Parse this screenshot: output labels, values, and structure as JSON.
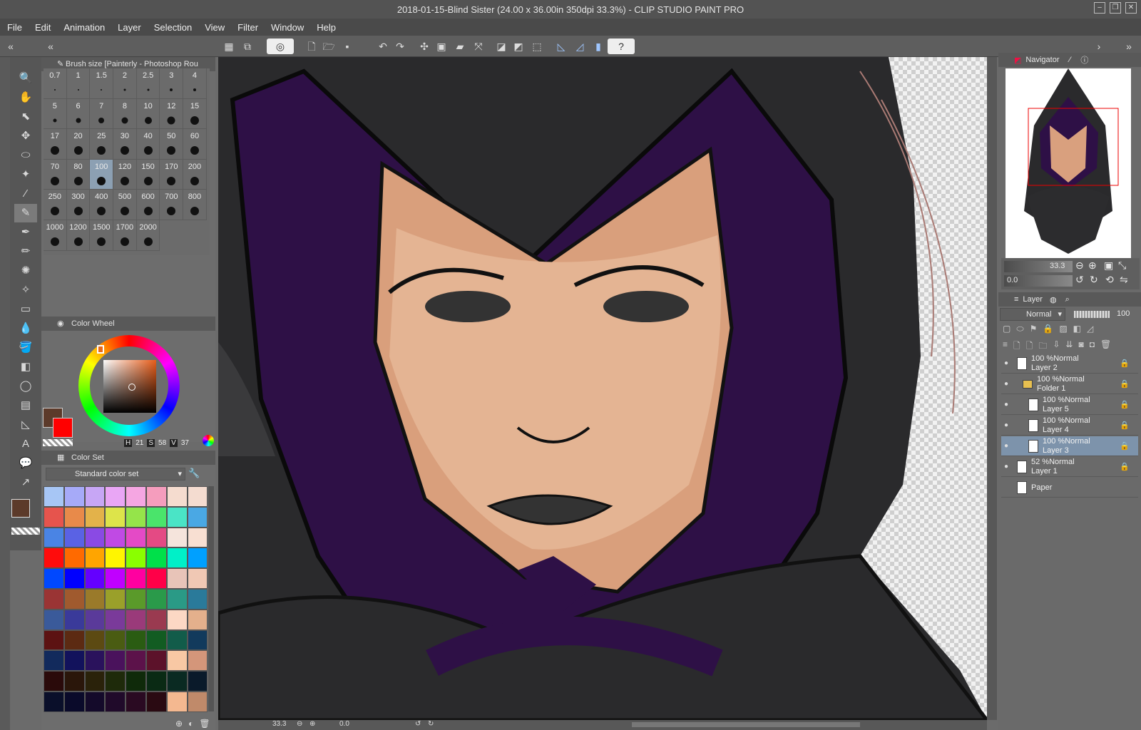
{
  "window": {
    "title": "2018-01-15-Blind Sister (24.00 x 36.00in 350dpi 33.3%)  - CLIP STUDIO PAINT PRO"
  },
  "menu": [
    "File",
    "Edit",
    "Animation",
    "Layer",
    "Selection",
    "View",
    "Filter",
    "Window",
    "Help"
  ],
  "tool_property": {
    "title": "Brush size [Painterly - Photoshop Rou"
  },
  "brush_sizes": [
    {
      "v": "0.7",
      "d": 2
    },
    {
      "v": "1",
      "d": 2
    },
    {
      "v": "1.5",
      "d": 2
    },
    {
      "v": "2",
      "d": 3
    },
    {
      "v": "2.5",
      "d": 3
    },
    {
      "v": "3",
      "d": 4
    },
    {
      "v": "4",
      "d": 4
    },
    {
      "v": "5",
      "d": 5
    },
    {
      "v": "6",
      "d": 7
    },
    {
      "v": "7",
      "d": 8
    },
    {
      "v": "8",
      "d": 9
    },
    {
      "v": "10",
      "d": 10
    },
    {
      "v": "12",
      "d": 11
    },
    {
      "v": "15",
      "d": 12
    },
    {
      "v": "17",
      "d": 12
    },
    {
      "v": "20",
      "d": 12
    },
    {
      "v": "25",
      "d": 12
    },
    {
      "v": "30",
      "d": 12
    },
    {
      "v": "40",
      "d": 12
    },
    {
      "v": "50",
      "d": 12
    },
    {
      "v": "60",
      "d": 12
    },
    {
      "v": "70",
      "d": 12
    },
    {
      "v": "80",
      "d": 12
    },
    {
      "v": "100",
      "d": 12
    },
    {
      "v": "120",
      "d": 12
    },
    {
      "v": "150",
      "d": 12
    },
    {
      "v": "170",
      "d": 12
    },
    {
      "v": "200",
      "d": 12
    },
    {
      "v": "250",
      "d": 12
    },
    {
      "v": "300",
      "d": 12
    },
    {
      "v": "400",
      "d": 12
    },
    {
      "v": "500",
      "d": 12
    },
    {
      "v": "600",
      "d": 12
    },
    {
      "v": "700",
      "d": 12
    },
    {
      "v": "800",
      "d": 12
    },
    {
      "v": "1000",
      "d": 12
    },
    {
      "v": "1200",
      "d": 12
    },
    {
      "v": "1500",
      "d": 12
    },
    {
      "v": "1700",
      "d": 12
    },
    {
      "v": "2000",
      "d": 12
    }
  ],
  "selected_brush": "100",
  "color_wheel": {
    "title": "Color Wheel",
    "h_label": "H",
    "h": "21",
    "s_label": "S",
    "s": "58",
    "v_label": "V",
    "v": "37"
  },
  "color_set": {
    "title": "Color Set",
    "selected": "Standard color set"
  },
  "colors": {
    "main": "#5c3a2a",
    "sub": "#ff0000",
    "set": [
      "#a7c6f5",
      "#a6aaf8",
      "#c7a6f5",
      "#e9a6f5",
      "#f5a6e2",
      "#f59dbd",
      "#f5dccf",
      "#f4dcd0",
      "#e6544d",
      "#e88a4a",
      "#e3b24a",
      "#dde44a",
      "#95e44a",
      "#4ae46b",
      "#4ae4c6",
      "#4aa8e4",
      "#4a84e4",
      "#5a62e4",
      "#8a4ae4",
      "#c04ae4",
      "#e44ac6",
      "#e44a84",
      "#f5e4dc",
      "#f8dfd2",
      "#ff0c0c",
      "#ff6a00",
      "#ffa500",
      "#fff500",
      "#8aff00",
      "#00e04a",
      "#00f0c8",
      "#00a0ff",
      "#0048ff",
      "#0000ff",
      "#6400ff",
      "#c000ff",
      "#ff00a0",
      "#ff0048",
      "#e8c4b8",
      "#f0c8b4",
      "#9a3434",
      "#a05a2e",
      "#9a7a2a",
      "#9aa02a",
      "#5a9a2a",
      "#2a9a4a",
      "#2a9a86",
      "#2a7a9a",
      "#3a5a9a",
      "#3a3a9a",
      "#5a3a9a",
      "#7a3a9a",
      "#9a3a7a",
      "#9a3a50",
      "#fcd8c4",
      "#e4b08c",
      "#5c1212",
      "#5c2a12",
      "#5c4a12",
      "#4a5c12",
      "#2a5c12",
      "#125c22",
      "#125c4a",
      "#123a5c",
      "#122a5c",
      "#12125c",
      "#2a125c",
      "#4a125c",
      "#5c124a",
      "#5c122a",
      "#f8c8a4",
      "#d4967a",
      "#2a0a0a",
      "#2a160a",
      "#2a220a",
      "#1e2a0a",
      "#0f2a0a",
      "#0a2a14",
      "#0a2a22",
      "#0a1a2a",
      "#0a0f2a",
      "#0a0a2a",
      "#140a2a",
      "#200a2a",
      "#2a0a22",
      "#2a0a12",
      "#f4b890",
      "#c08a6a"
    ]
  },
  "navigator": {
    "title": "Navigator",
    "zoom": "33.3",
    "angle": "0.0"
  },
  "layer_panel": {
    "title": "Layer",
    "blend": "Normal",
    "opacity": "100"
  },
  "layers": [
    {
      "info": "100 %Normal",
      "name": "Layer 2",
      "indent": 0,
      "sel": false
    },
    {
      "info": "100 %Normal",
      "name": "Folder 1",
      "indent": 1,
      "sel": false
    },
    {
      "info": "100 %Normal",
      "name": "Layer 5",
      "indent": 2,
      "sel": false
    },
    {
      "info": "100 %Normal",
      "name": "Layer 4",
      "indent": 2,
      "sel": false
    },
    {
      "info": "100 %Normal",
      "name": "Layer 3",
      "indent": 2,
      "sel": true
    },
    {
      "info": "52 %Normal",
      "name": "Layer 1",
      "indent": 0,
      "sel": false
    },
    {
      "info": "",
      "name": "Paper",
      "indent": 0,
      "sel": false
    }
  ],
  "status": {
    "zoom": "33.3",
    "angle": "0.0"
  }
}
